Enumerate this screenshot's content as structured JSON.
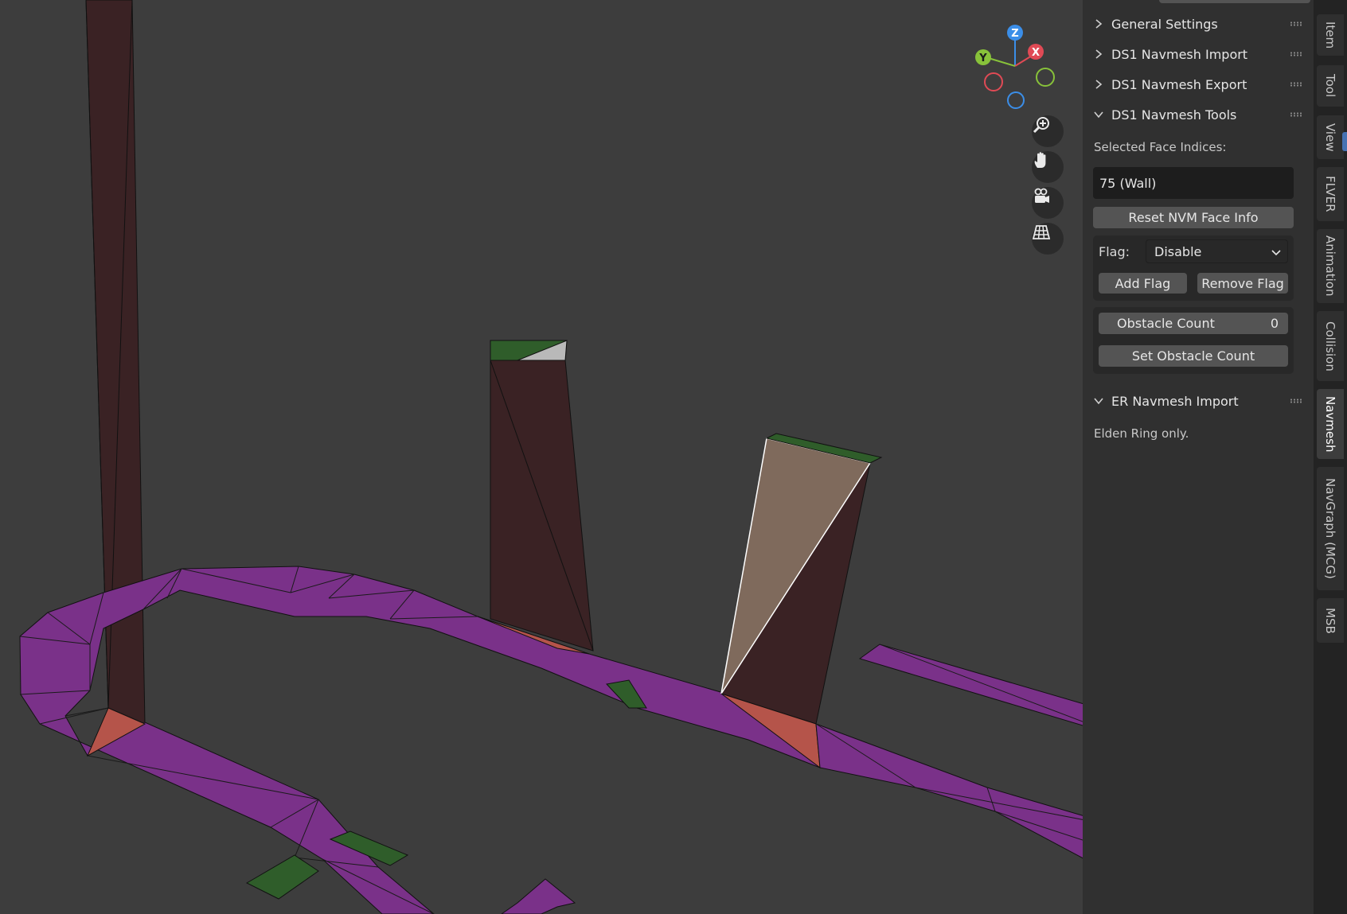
{
  "gizmo": {
    "z": "Z",
    "y": "Y",
    "x": "X"
  },
  "panels": {
    "general_settings": "General Settings",
    "ds1_import": "DS1 Navmesh Import",
    "ds1_export": "DS1 Navmesh Export",
    "ds1_tools": "DS1 Navmesh Tools",
    "er_import": "ER Navmesh Import"
  },
  "tools": {
    "selected_label": "Selected Face Indices:",
    "selected_value": "75 (Wall)",
    "reset_button": "Reset NVM Face Info",
    "flag_label": "Flag:",
    "flag_value": "Disable",
    "add_flag": "Add Flag",
    "remove_flag": "Remove Flag",
    "obstacle_label": "Obstacle Count",
    "obstacle_value": "0",
    "set_obstacle": "Set Obstacle Count"
  },
  "er_note": "Elden Ring only.",
  "tabs": [
    "Item",
    "Tool",
    "View",
    "FLVER",
    "Animation",
    "Collision",
    "Navmesh",
    "NavGraph (MCG)",
    "MSB"
  ],
  "active_tab": "Navmesh",
  "colors": {
    "viewport_bg": "#3d3d3d",
    "floor_face": "#7a3189",
    "wall_face": "#3a2224",
    "flagged_face": "#b5544a",
    "selected_face": "#7f6a5c",
    "green_face": "#2f5d2a"
  },
  "icons": [
    "zoom-icon",
    "pan-hand-icon",
    "camera-icon",
    "perspective-grid-icon",
    "chevron-right-icon",
    "chevron-down-icon",
    "grip-icon"
  ]
}
